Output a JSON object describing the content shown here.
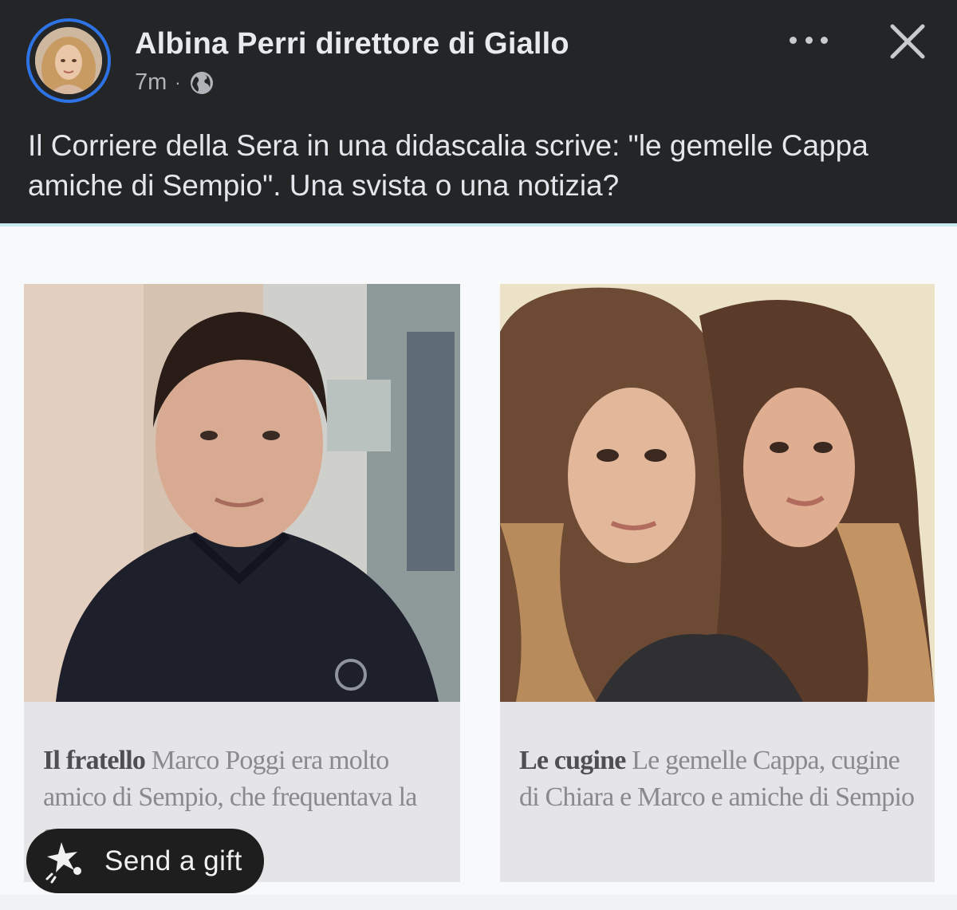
{
  "post": {
    "author": "Albina Perri direttore di Giallo",
    "time": "7m",
    "separator": "·",
    "audience_icon": "globe-icon",
    "text": "Il Corriere della Sera in una didascalia scrive: \"le gemelle Cappa amiche di Sempio\". Una svista o una notizia?"
  },
  "actions": {
    "more_icon": "more-options-icon",
    "close_icon": "close-icon"
  },
  "image": {
    "left": {
      "caption_bold": "Il fratello",
      "caption_rest": " Marco Poggi era molto amico di Sempio, che frequentava la sua casa"
    },
    "right": {
      "caption_bold": "Le cugine",
      "caption_rest": " Le gemelle Cappa, cugine di Chiara e Marco e amiche di Sempio"
    }
  },
  "gift": {
    "label": "Send a gift",
    "icon": "gift-sparkle-icon"
  },
  "colors": {
    "header_bg": "#242526",
    "avatar_ring": "#2d73e6",
    "gift_pill_bg": "#1e1e1f"
  }
}
